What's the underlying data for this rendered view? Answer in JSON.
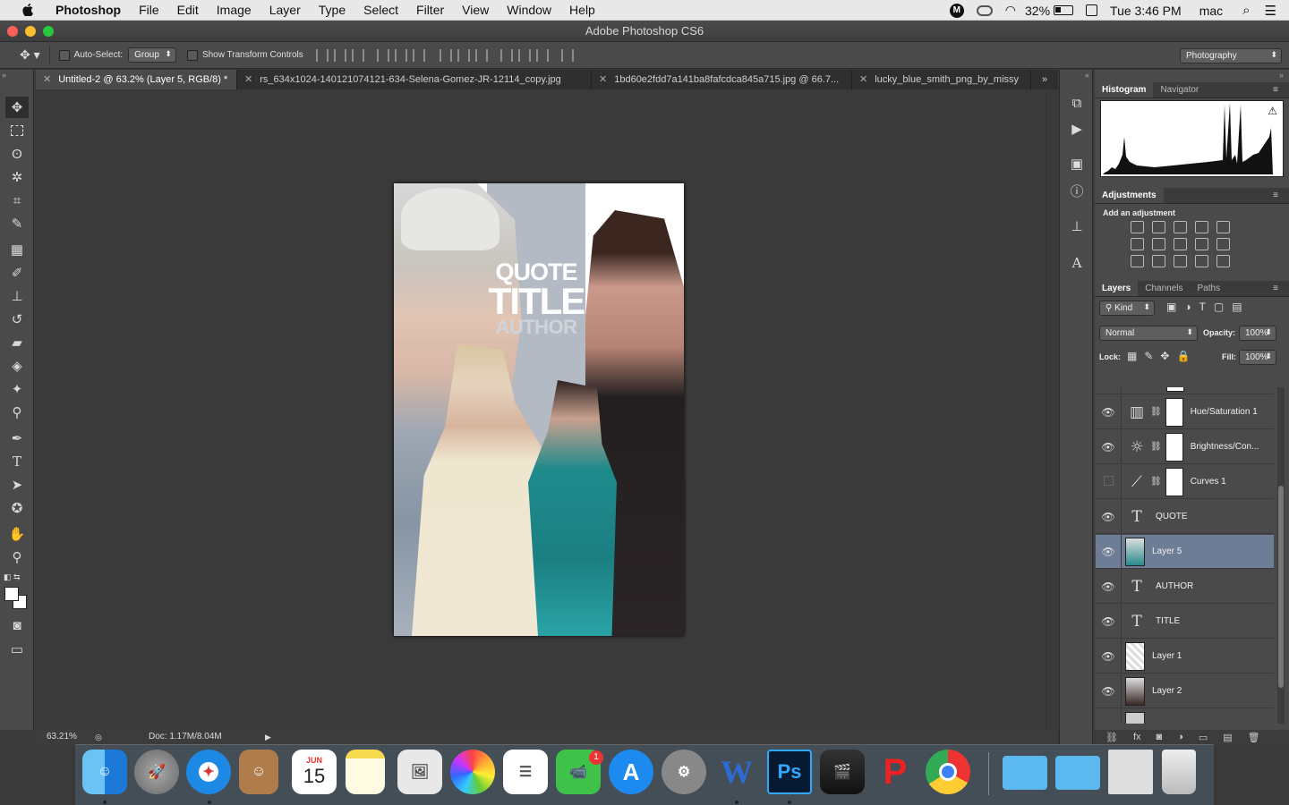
{
  "menubar": {
    "app": "Photoshop",
    "items": [
      "File",
      "Edit",
      "Image",
      "Layer",
      "Type",
      "Select",
      "Filter",
      "View",
      "Window",
      "Help"
    ],
    "battery": "32%",
    "clock": "Tue 3:46 PM",
    "user": "mac"
  },
  "window": {
    "title": "Adobe Photoshop CS6"
  },
  "options": {
    "auto_select_label": "Auto-Select:",
    "auto_select_value": "Group",
    "transform_label": "Show Transform Controls",
    "workspace": "Photography"
  },
  "tabs": [
    {
      "label": "Untitled-2 @ 63.2% (Layer 5, RGB/8) *"
    },
    {
      "label": "rs_634x1024-140121074121-634-Selena-Gomez-JR-12114_copy.jpg"
    },
    {
      "label": "1bd60e2fdd7a141ba8fafcdca845a715.jpg @ 66.7..."
    },
    {
      "label": "lucky_blue_smith_png_by_missy"
    }
  ],
  "canvas": {
    "quote": "QUOTE",
    "title": "TITLE",
    "author": "AUTHOR"
  },
  "status": {
    "zoom": "63.21%",
    "doc": "Doc: 1.17M/8.04M"
  },
  "panels": {
    "histogram_tab": "Histogram",
    "navigator_tab": "Navigator",
    "adjustments_tab": "Adjustments",
    "add_adjustment": "Add an adjustment",
    "layers_tab": "Layers",
    "channels_tab": "Channels",
    "paths_tab": "Paths",
    "kind": "Kind",
    "blend_mode": "Normal",
    "opacity_label": "Opacity:",
    "opacity": "100%",
    "lock_label": "Lock:",
    "fill_label": "Fill:",
    "fill": "100%"
  },
  "layers": [
    {
      "name": "Hue/Saturation 1"
    },
    {
      "name": "Brightness/Con..."
    },
    {
      "name": "Curves 1"
    },
    {
      "name": "QUOTE"
    },
    {
      "name": "Layer 5"
    },
    {
      "name": "AUTHOR"
    },
    {
      "name": "TITLE"
    },
    {
      "name": "Layer 1"
    },
    {
      "name": "Layer 2"
    }
  ],
  "dock": {
    "calendar_month": "JUN",
    "calendar_day": "15",
    "facetime_badge": "1"
  }
}
